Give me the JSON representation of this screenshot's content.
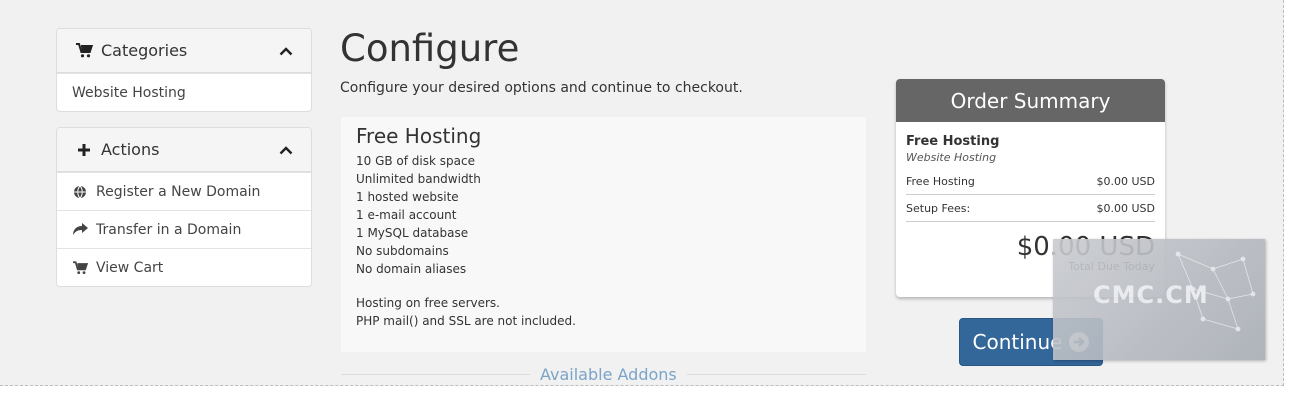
{
  "sidebar": {
    "categories": {
      "title": "Categories",
      "items": [
        {
          "label": "Website Hosting"
        }
      ]
    },
    "actions": {
      "title": "Actions",
      "items": [
        {
          "label": "Register a New Domain",
          "icon": "globe-icon"
        },
        {
          "label": "Transfer in a Domain",
          "icon": "share-arrow-icon"
        },
        {
          "label": "View Cart",
          "icon": "cart-icon"
        }
      ]
    }
  },
  "main": {
    "title": "Configure",
    "subtitle": "Configure your desired options and continue to checkout.",
    "product": {
      "name": "Free Hosting",
      "features": [
        "10 GB of disk space",
        "Unlimited bandwidth",
        "1 hosted website",
        "1 e-mail account",
        "1 MySQL database",
        "No subdomains",
        "No domain aliases"
      ],
      "notes": [
        "Hosting on free servers.",
        "PHP mail() and SSL are not included."
      ]
    },
    "addons_heading": "Available Addons"
  },
  "summary": {
    "title": "Order Summary",
    "product_name": "Free Hosting",
    "product_group": "Website Hosting",
    "lines": [
      {
        "label": "Free Hosting",
        "value": "$0.00 USD"
      },
      {
        "label": "Setup Fees:",
        "value": "$0.00 USD"
      }
    ],
    "total": "$0.00 USD",
    "total_label": "Total Due Today",
    "continue_label": "Continue"
  },
  "watermark": {
    "text": "CMC.CM"
  },
  "colors": {
    "background": "#f1f1f1",
    "summary_header": "#666666",
    "continue_button": "#336699",
    "addons_link": "#7aa4c8"
  }
}
